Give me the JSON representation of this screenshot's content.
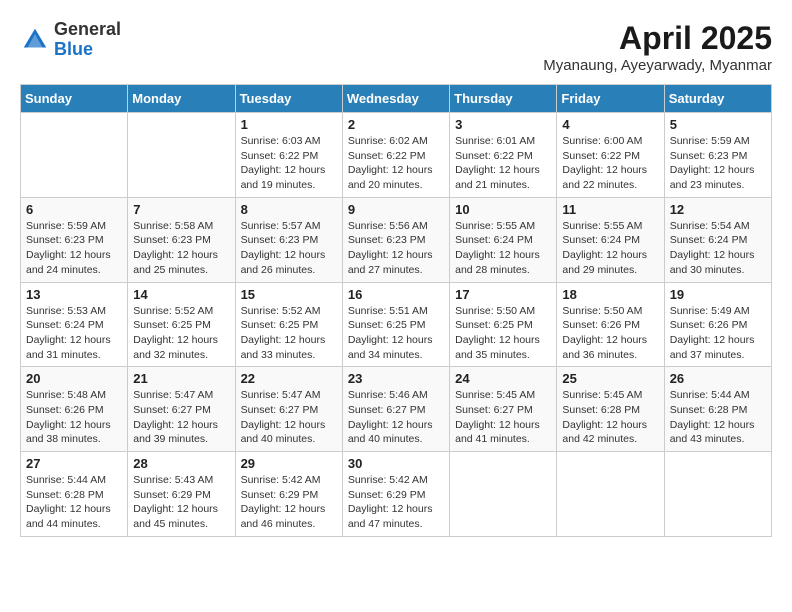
{
  "header": {
    "logo_general": "General",
    "logo_blue": "Blue",
    "month_title": "April 2025",
    "subtitle": "Myanaung, Ayeyarwady, Myanmar"
  },
  "days_of_week": [
    "Sunday",
    "Monday",
    "Tuesday",
    "Wednesday",
    "Thursday",
    "Friday",
    "Saturday"
  ],
  "weeks": [
    [
      {
        "day": "",
        "info": ""
      },
      {
        "day": "",
        "info": ""
      },
      {
        "day": "1",
        "info": "Sunrise: 6:03 AM\nSunset: 6:22 PM\nDaylight: 12 hours and 19 minutes."
      },
      {
        "day": "2",
        "info": "Sunrise: 6:02 AM\nSunset: 6:22 PM\nDaylight: 12 hours and 20 minutes."
      },
      {
        "day": "3",
        "info": "Sunrise: 6:01 AM\nSunset: 6:22 PM\nDaylight: 12 hours and 21 minutes."
      },
      {
        "day": "4",
        "info": "Sunrise: 6:00 AM\nSunset: 6:22 PM\nDaylight: 12 hours and 22 minutes."
      },
      {
        "day": "5",
        "info": "Sunrise: 5:59 AM\nSunset: 6:23 PM\nDaylight: 12 hours and 23 minutes."
      }
    ],
    [
      {
        "day": "6",
        "info": "Sunrise: 5:59 AM\nSunset: 6:23 PM\nDaylight: 12 hours and 24 minutes."
      },
      {
        "day": "7",
        "info": "Sunrise: 5:58 AM\nSunset: 6:23 PM\nDaylight: 12 hours and 25 minutes."
      },
      {
        "day": "8",
        "info": "Sunrise: 5:57 AM\nSunset: 6:23 PM\nDaylight: 12 hours and 26 minutes."
      },
      {
        "day": "9",
        "info": "Sunrise: 5:56 AM\nSunset: 6:23 PM\nDaylight: 12 hours and 27 minutes."
      },
      {
        "day": "10",
        "info": "Sunrise: 5:55 AM\nSunset: 6:24 PM\nDaylight: 12 hours and 28 minutes."
      },
      {
        "day": "11",
        "info": "Sunrise: 5:55 AM\nSunset: 6:24 PM\nDaylight: 12 hours and 29 minutes."
      },
      {
        "day": "12",
        "info": "Sunrise: 5:54 AM\nSunset: 6:24 PM\nDaylight: 12 hours and 30 minutes."
      }
    ],
    [
      {
        "day": "13",
        "info": "Sunrise: 5:53 AM\nSunset: 6:24 PM\nDaylight: 12 hours and 31 minutes."
      },
      {
        "day": "14",
        "info": "Sunrise: 5:52 AM\nSunset: 6:25 PM\nDaylight: 12 hours and 32 minutes."
      },
      {
        "day": "15",
        "info": "Sunrise: 5:52 AM\nSunset: 6:25 PM\nDaylight: 12 hours and 33 minutes."
      },
      {
        "day": "16",
        "info": "Sunrise: 5:51 AM\nSunset: 6:25 PM\nDaylight: 12 hours and 34 minutes."
      },
      {
        "day": "17",
        "info": "Sunrise: 5:50 AM\nSunset: 6:25 PM\nDaylight: 12 hours and 35 minutes."
      },
      {
        "day": "18",
        "info": "Sunrise: 5:50 AM\nSunset: 6:26 PM\nDaylight: 12 hours and 36 minutes."
      },
      {
        "day": "19",
        "info": "Sunrise: 5:49 AM\nSunset: 6:26 PM\nDaylight: 12 hours and 37 minutes."
      }
    ],
    [
      {
        "day": "20",
        "info": "Sunrise: 5:48 AM\nSunset: 6:26 PM\nDaylight: 12 hours and 38 minutes."
      },
      {
        "day": "21",
        "info": "Sunrise: 5:47 AM\nSunset: 6:27 PM\nDaylight: 12 hours and 39 minutes."
      },
      {
        "day": "22",
        "info": "Sunrise: 5:47 AM\nSunset: 6:27 PM\nDaylight: 12 hours and 40 minutes."
      },
      {
        "day": "23",
        "info": "Sunrise: 5:46 AM\nSunset: 6:27 PM\nDaylight: 12 hours and 40 minutes."
      },
      {
        "day": "24",
        "info": "Sunrise: 5:45 AM\nSunset: 6:27 PM\nDaylight: 12 hours and 41 minutes."
      },
      {
        "day": "25",
        "info": "Sunrise: 5:45 AM\nSunset: 6:28 PM\nDaylight: 12 hours and 42 minutes."
      },
      {
        "day": "26",
        "info": "Sunrise: 5:44 AM\nSunset: 6:28 PM\nDaylight: 12 hours and 43 minutes."
      }
    ],
    [
      {
        "day": "27",
        "info": "Sunrise: 5:44 AM\nSunset: 6:28 PM\nDaylight: 12 hours and 44 minutes."
      },
      {
        "day": "28",
        "info": "Sunrise: 5:43 AM\nSunset: 6:29 PM\nDaylight: 12 hours and 45 minutes."
      },
      {
        "day": "29",
        "info": "Sunrise: 5:42 AM\nSunset: 6:29 PM\nDaylight: 12 hours and 46 minutes."
      },
      {
        "day": "30",
        "info": "Sunrise: 5:42 AM\nSunset: 6:29 PM\nDaylight: 12 hours and 47 minutes."
      },
      {
        "day": "",
        "info": ""
      },
      {
        "day": "",
        "info": ""
      },
      {
        "day": "",
        "info": ""
      }
    ]
  ]
}
